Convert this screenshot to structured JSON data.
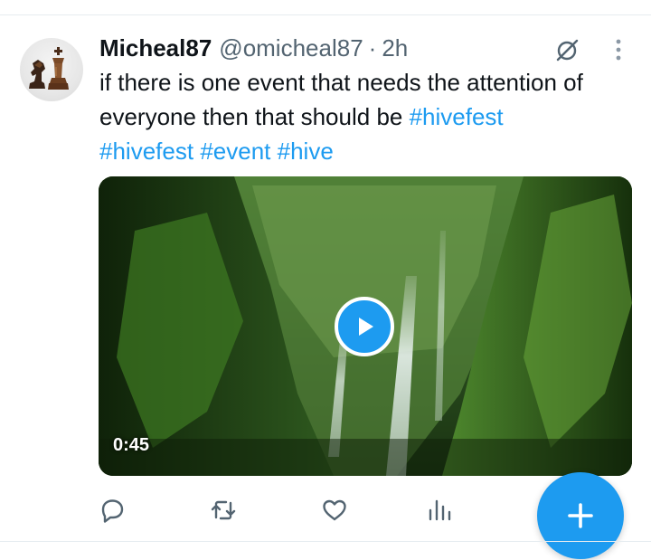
{
  "tweet": {
    "display_name": "Micheal87",
    "handle": "@omicheal87",
    "separator": "·",
    "time": "2h",
    "text_plain": "if there is one event that needs the attention of everyone then that should be ",
    "hashtags": [
      "#hivefest",
      "#hivefest",
      "#event",
      "#hive"
    ],
    "media": {
      "duration": "0:45"
    }
  },
  "actions": [
    {
      "icon": "reply-icon"
    },
    {
      "icon": "retweet-icon"
    },
    {
      "icon": "like-icon"
    },
    {
      "icon": "views-icon"
    }
  ],
  "fab": {
    "icon": "plus-icon"
  },
  "colors": {
    "accent": "#1d9bf0",
    "text": "#0f1419",
    "secondary_text": "#536471",
    "divider": "#e6ecf0"
  }
}
